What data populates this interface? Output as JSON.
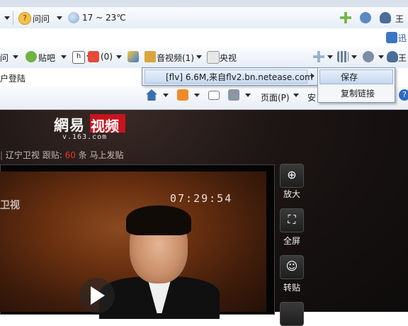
{
  "toolbar_top": {
    "items": [
      "问问",
      "17 ~ 23℃"
    ],
    "user_label": "王"
  },
  "toolbar_links": {
    "label": "迅"
  },
  "toolbar_main": {
    "items": [
      "问",
      "贴吧",
      "(0)",
      "音视频(1)",
      "央视"
    ],
    "user_label": "王"
  },
  "side_text": {
    "login": "户登陆"
  },
  "command_bar": {
    "page_label": "页面(P)",
    "safety_label": "安"
  },
  "media_menu": {
    "item": "[flv] 6.6M,来自flv2.bn.netease.com"
  },
  "sub_menu": {
    "save": "保存",
    "copy_link": "复制链接"
  },
  "page": {
    "logo_text": "網易",
    "logo_red": "视频",
    "logo_url": "v.163.com",
    "info_channel": "辽宁卫视",
    "info_follow": "跟贴:",
    "info_count": "60",
    "info_unit": "条",
    "info_post": "马上发贴",
    "timecode": "07:29:54",
    "tv_logo": "卫视"
  },
  "side_controls": [
    {
      "label": "放大"
    },
    {
      "label": "全屏"
    },
    {
      "label": "转贴"
    }
  ],
  "colors": {
    "accent_red": "#c8141e",
    "menu_border": "#7a8fae"
  }
}
